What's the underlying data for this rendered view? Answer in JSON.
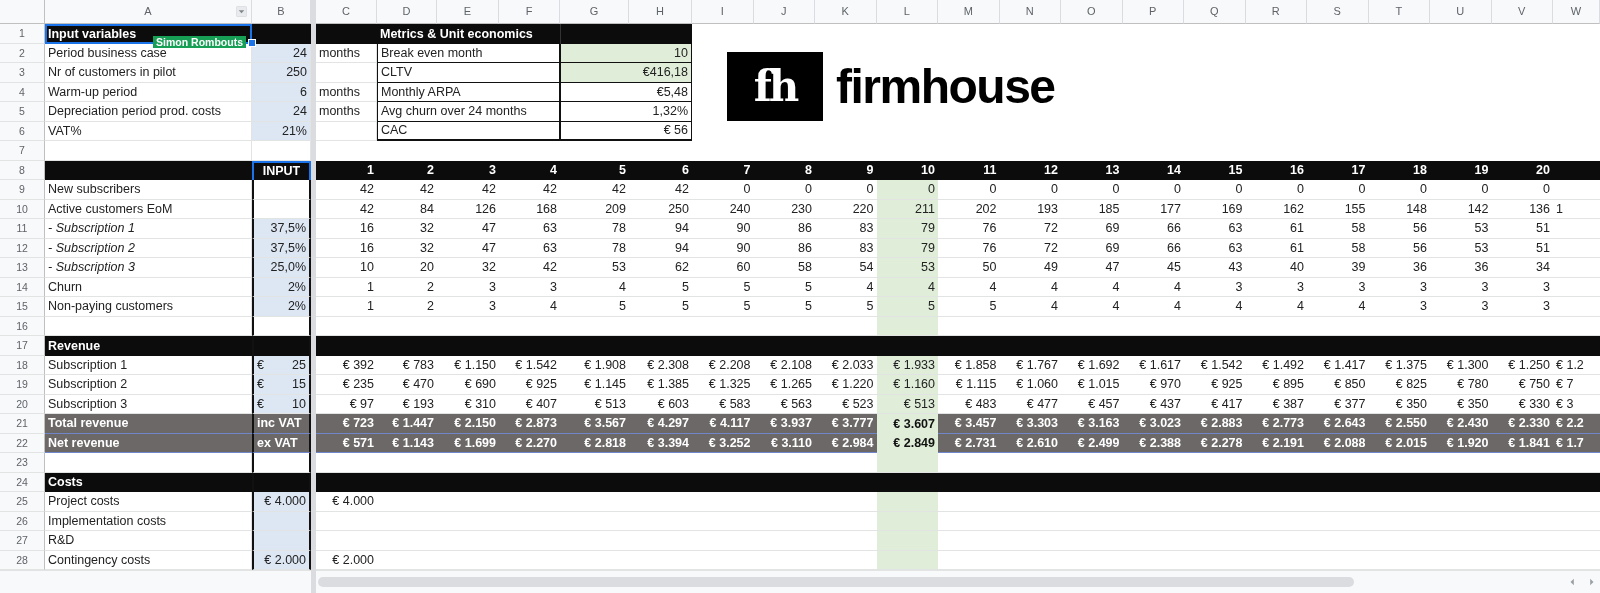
{
  "column_headers": [
    {
      "label": "A",
      "filter": true
    },
    {
      "label": "B",
      "filter": false
    },
    {
      "label": "C",
      "filter": false
    },
    {
      "label": "D",
      "filter": false
    },
    {
      "label": "E",
      "filter": false
    },
    {
      "label": "F",
      "filter": false
    },
    {
      "label": "G",
      "filter": false
    },
    {
      "label": "H",
      "filter": false
    },
    {
      "label": "I",
      "filter": false
    },
    {
      "label": "J",
      "filter": false
    },
    {
      "label": "K",
      "filter": false
    },
    {
      "label": "L",
      "filter": false
    },
    {
      "label": "M",
      "filter": false
    },
    {
      "label": "N",
      "filter": false
    },
    {
      "label": "O",
      "filter": false
    },
    {
      "label": "P",
      "filter": false
    },
    {
      "label": "Q",
      "filter": false
    },
    {
      "label": "R",
      "filter": false
    },
    {
      "label": "S",
      "filter": false
    },
    {
      "label": "T",
      "filter": false
    },
    {
      "label": "U",
      "filter": false
    },
    {
      "label": "V",
      "filter": false
    },
    {
      "label": "W",
      "filter": false
    }
  ],
  "row_numbers": [
    "1",
    "2",
    "3",
    "4",
    "5",
    "6",
    "7",
    "8",
    "9",
    "10",
    "11",
    "12",
    "13",
    "14",
    "15",
    "16",
    "17",
    "18",
    "19",
    "20",
    "21",
    "22",
    "23",
    "24",
    "25",
    "26",
    "27",
    "28"
  ],
  "collaborator": {
    "name": "Simon Rombouts",
    "color": "#169f55"
  },
  "input_variables": {
    "title": "Input variables",
    "rows": [
      {
        "label": "Period business case",
        "value": "24",
        "unit": "months"
      },
      {
        "label": "Nr of customers in pilot",
        "value": "250"
      },
      {
        "label": "Warm-up period",
        "value": "6",
        "unit": "months"
      },
      {
        "label": "Depreciation period prod. costs",
        "value": "24",
        "unit": "months"
      },
      {
        "label": "VAT%",
        "value": "21%"
      }
    ]
  },
  "metrics": {
    "title": "Metrics & Unit economics",
    "rows": [
      {
        "label": "Break even month",
        "value": "10",
        "highlighted": true
      },
      {
        "label": "CLTV",
        "value": "€416,18",
        "highlighted": true
      },
      {
        "label": "Monthly ARPA",
        "value": "€5,48",
        "highlighted": false
      },
      {
        "label": "Avg churn over 24 months",
        "value": "1,32%",
        "highlighted": false
      },
      {
        "label": "CAC",
        "value": "€ 56",
        "highlighted": false
      }
    ]
  },
  "logo": {
    "mark": "fh",
    "name": "firmhouse"
  },
  "model": {
    "input_header": "INPUT",
    "months": [
      {
        "label": "1",
        "highlighted": false
      },
      {
        "label": "2",
        "highlighted": false
      },
      {
        "label": "3",
        "highlighted": false
      },
      {
        "label": "4",
        "highlighted": false
      },
      {
        "label": "5",
        "highlighted": false
      },
      {
        "label": "6",
        "highlighted": false
      },
      {
        "label": "7",
        "highlighted": false
      },
      {
        "label": "8",
        "highlighted": false
      },
      {
        "label": "9",
        "highlighted": false
      },
      {
        "label": "10",
        "highlighted": true
      },
      {
        "label": "11",
        "highlighted": false
      },
      {
        "label": "12",
        "highlighted": false
      },
      {
        "label": "13",
        "highlighted": false
      },
      {
        "label": "14",
        "highlighted": false
      },
      {
        "label": "15",
        "highlighted": false
      },
      {
        "label": "16",
        "highlighted": false
      },
      {
        "label": "17",
        "highlighted": false
      },
      {
        "label": "18",
        "highlighted": false
      },
      {
        "label": "19",
        "highlighted": false
      },
      {
        "label": "20",
        "highlighted": false
      }
    ],
    "rows": [
      {
        "kind": "data",
        "label": "New subscribers",
        "input_fill": false,
        "values": [
          "42",
          "42",
          "42",
          "42",
          "42",
          "42",
          "0",
          "0",
          "0",
          "0",
          "0",
          "0",
          "0",
          "0",
          "0",
          "0",
          "0",
          "0",
          "0",
          "0"
        ]
      },
      {
        "kind": "data",
        "label": "Active customers EoM",
        "input_fill": false,
        "values": [
          "42",
          "84",
          "126",
          "168",
          "209",
          "250",
          "240",
          "230",
          "220",
          "211",
          "202",
          "193",
          "185",
          "177",
          "169",
          "162",
          "155",
          "148",
          "142",
          "136",
          "1"
        ]
      },
      {
        "kind": "sub",
        "label": "- Subscription 1",
        "input_fill": true,
        "input": {
          "text": "37,5%"
        },
        "values": [
          "16",
          "32",
          "47",
          "63",
          "78",
          "94",
          "90",
          "86",
          "83",
          "79",
          "76",
          "72",
          "69",
          "66",
          "63",
          "61",
          "58",
          "56",
          "53",
          "51"
        ]
      },
      {
        "kind": "sub",
        "label": "- Subscription 2",
        "input_fill": true,
        "input": {
          "text": "37,5%"
        },
        "values": [
          "16",
          "32",
          "47",
          "63",
          "78",
          "94",
          "90",
          "86",
          "83",
          "79",
          "76",
          "72",
          "69",
          "66",
          "63",
          "61",
          "58",
          "56",
          "53",
          "51"
        ]
      },
      {
        "kind": "sub",
        "label": "- Subscription 3",
        "input_fill": true,
        "input": {
          "text": "25,0%"
        },
        "values": [
          "10",
          "20",
          "32",
          "42",
          "53",
          "62",
          "60",
          "58",
          "54",
          "53",
          "50",
          "49",
          "47",
          "45",
          "43",
          "40",
          "39",
          "36",
          "36",
          "34"
        ]
      },
      {
        "kind": "data",
        "label": "Churn",
        "input_fill": true,
        "input": {
          "text": "2%"
        },
        "values": [
          "1",
          "2",
          "3",
          "3",
          "4",
          "5",
          "5",
          "5",
          "4",
          "4",
          "4",
          "4",
          "4",
          "4",
          "3",
          "3",
          "3",
          "3",
          "3",
          "3"
        ]
      },
      {
        "kind": "data",
        "label": "Non-paying customers",
        "input_fill": true,
        "input": {
          "text": "2%"
        },
        "values": [
          "1",
          "2",
          "3",
          "4",
          "5",
          "5",
          "5",
          "5",
          "5",
          "5",
          "5",
          "4",
          "4",
          "4",
          "4",
          "4",
          "4",
          "3",
          "3",
          "3"
        ]
      },
      {
        "kind": "blank",
        "input_fill": false
      },
      {
        "kind": "section",
        "label": "Revenue",
        "input_fill": false
      },
      {
        "kind": "data",
        "label": "Subscription 1",
        "input_fill": true,
        "input": {
          "currency": "€",
          "text": "25"
        },
        "values": [
          "€ 392",
          "€ 783",
          "€ 1.150",
          "€ 1.542",
          "€ 1.908",
          "€ 2.308",
          "€ 2.208",
          "€ 2.108",
          "€ 2.033",
          "€ 1.933",
          "€ 1.858",
          "€ 1.767",
          "€ 1.692",
          "€ 1.617",
          "€ 1.542",
          "€ 1.492",
          "€ 1.417",
          "€ 1.375",
          "€ 1.300",
          "€ 1.250",
          "€ 1.2"
        ]
      },
      {
        "kind": "data",
        "label": "Subscription 2",
        "input_fill": true,
        "input": {
          "currency": "€",
          "text": "15"
        },
        "values": [
          "€ 235",
          "€ 470",
          "€ 690",
          "€ 925",
          "€ 1.145",
          "€ 1.385",
          "€ 1.325",
          "€ 1.265",
          "€ 1.220",
          "€ 1.160",
          "€ 1.115",
          "€ 1.060",
          "€ 1.015",
          "€ 970",
          "€ 925",
          "€ 895",
          "€ 850",
          "€ 825",
          "€ 780",
          "€ 750",
          "€ 7"
        ]
      },
      {
        "kind": "data",
        "label": "Subscription 3",
        "input_fill": true,
        "input": {
          "currency": "€",
          "text": "10"
        },
        "values": [
          "€ 97",
          "€ 193",
          "€ 310",
          "€ 407",
          "€ 513",
          "€ 603",
          "€ 583",
          "€ 563",
          "€ 523",
          "€ 513",
          "€ 483",
          "€ 477",
          "€ 457",
          "€ 437",
          "€ 417",
          "€ 387",
          "€ 377",
          "€ 350",
          "€ 350",
          "€ 330",
          "€ 3"
        ]
      },
      {
        "kind": "total",
        "label": "Total revenue",
        "input_fill": false,
        "input": {
          "text": "inc VAT"
        },
        "values": [
          "€ 723",
          "€ 1.447",
          "€ 2.150",
          "€ 2.873",
          "€ 3.567",
          "€ 4.297",
          "€ 4.117",
          "€ 3.937",
          "€ 3.777",
          "€ 3.607",
          "€ 3.457",
          "€ 3.303",
          "€ 3.163",
          "€ 3.023",
          "€ 2.883",
          "€ 2.773",
          "€ 2.643",
          "€ 2.550",
          "€ 2.430",
          "€ 2.330",
          "€ 2.2"
        ]
      },
      {
        "kind": "total",
        "label": "Net revenue",
        "input_fill": false,
        "input": {
          "text": "ex VAT"
        },
        "values": [
          "€ 571",
          "€ 1.143",
          "€ 1.699",
          "€ 2.270",
          "€ 2.818",
          "€ 3.394",
          "€ 3.252",
          "€ 3.110",
          "€ 2.984",
          "€ 2.849",
          "€ 2.731",
          "€ 2.610",
          "€ 2.499",
          "€ 2.388",
          "€ 2.278",
          "€ 2.191",
          "€ 2.088",
          "€ 2.015",
          "€ 1.920",
          "€ 1.841",
          "€ 1.7"
        ]
      },
      {
        "kind": "blank",
        "input_fill": false
      },
      {
        "kind": "section",
        "label": "Costs",
        "input_fill": false
      },
      {
        "kind": "data",
        "label": "Project costs",
        "input_fill": true,
        "input": {
          "text": "€ 4.000"
        },
        "values": [
          "€ 4.000"
        ]
      },
      {
        "kind": "data",
        "label": "Implementation costs",
        "input_fill": true
      },
      {
        "kind": "data",
        "label": "R&D",
        "input_fill": true
      },
      {
        "kind": "data",
        "label": "Contingency costs",
        "input_fill": true,
        "input": {
          "text": "€ 2.000"
        },
        "values": [
          "€ 2.000"
        ]
      }
    ]
  }
}
